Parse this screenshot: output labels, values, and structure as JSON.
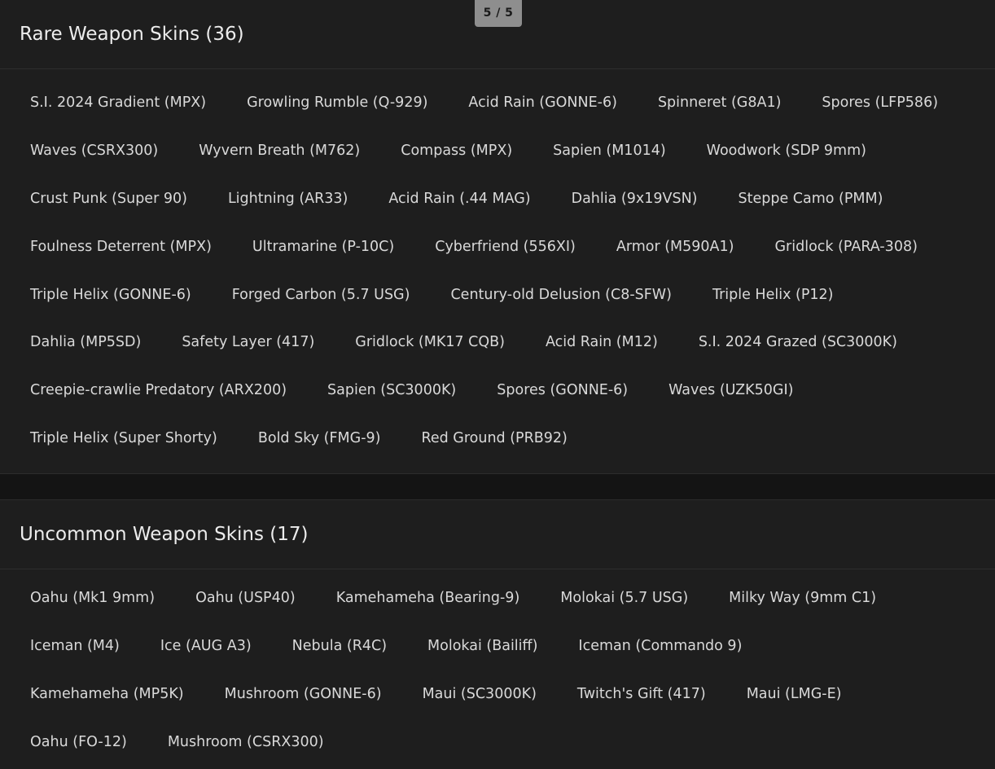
{
  "pager": {
    "label": "5 / 5"
  },
  "rare": {
    "title": "Rare Weapon Skins (36)",
    "rows": [
      [
        "S.I. 2024 Gradient (MPX)",
        "Growling Rumble (Q-929)",
        "Acid Rain (GONNE-6)",
        "Spinneret (G8A1)",
        "Spores (LFP586)"
      ],
      [
        "Waves (CSRX300)",
        "Wyvern Breath (M762)",
        "Compass (MPX)",
        "Sapien (M1014)",
        "Woodwork (SDP 9mm)"
      ],
      [
        "Crust Punk (Super 90)",
        "Lightning (AR33)",
        "Acid Rain (.44 MAG)",
        "Dahlia (9x19VSN)",
        "Steppe Camo (PMM)"
      ],
      [
        "Foulness Deterrent (MPX)",
        "Ultramarine (P-10C)",
        "Cyberfriend (556XI)",
        "Armor (M590A1)",
        "Gridlock (PARA-308)"
      ],
      [
        "Triple Helix (GONNE-6)",
        "Forged Carbon (5.7 USG)",
        "Century-old Delusion (C8-SFW)",
        "Triple Helix (P12)"
      ],
      [
        "Dahlia (MP5SD)",
        "Safety Layer (417)",
        "Gridlock (MK17 CQB)",
        "Acid Rain (M12)",
        "S.I. 2024 Grazed (SC3000K)"
      ],
      [
        "Creepie-crawlie Predatory (ARX200)",
        "Sapien (SC3000K)",
        "Spores (GONNE-6)",
        "Waves (UZK50GI)"
      ],
      [
        "Triple Helix (Super Shorty)",
        "Bold Sky (FMG-9)",
        "Red Ground (PRB92)"
      ]
    ]
  },
  "uncommon": {
    "title": "Uncommon Weapon Skins (17)",
    "rows": [
      [
        "Oahu (Mk1 9mm)",
        "Oahu (USP40)",
        "Kamehameha (Bearing-9)",
        "Molokai (5.7 USG)",
        "Milky Way (9mm C1)"
      ],
      [
        "Iceman (M4)",
        "Ice (AUG A3)",
        "Nebula (R4C)",
        "Molokai (Bailiff)",
        "Iceman (Commando 9)"
      ],
      [
        "Kamehameha (MP5K)",
        "Mushroom (GONNE-6)",
        "Maui (SC3000K)",
        "Twitch's Gift (417)",
        "Maui (LMG-E)"
      ],
      [
        "Oahu (FO-12)",
        "Mushroom (CSRX300)"
      ]
    ]
  }
}
